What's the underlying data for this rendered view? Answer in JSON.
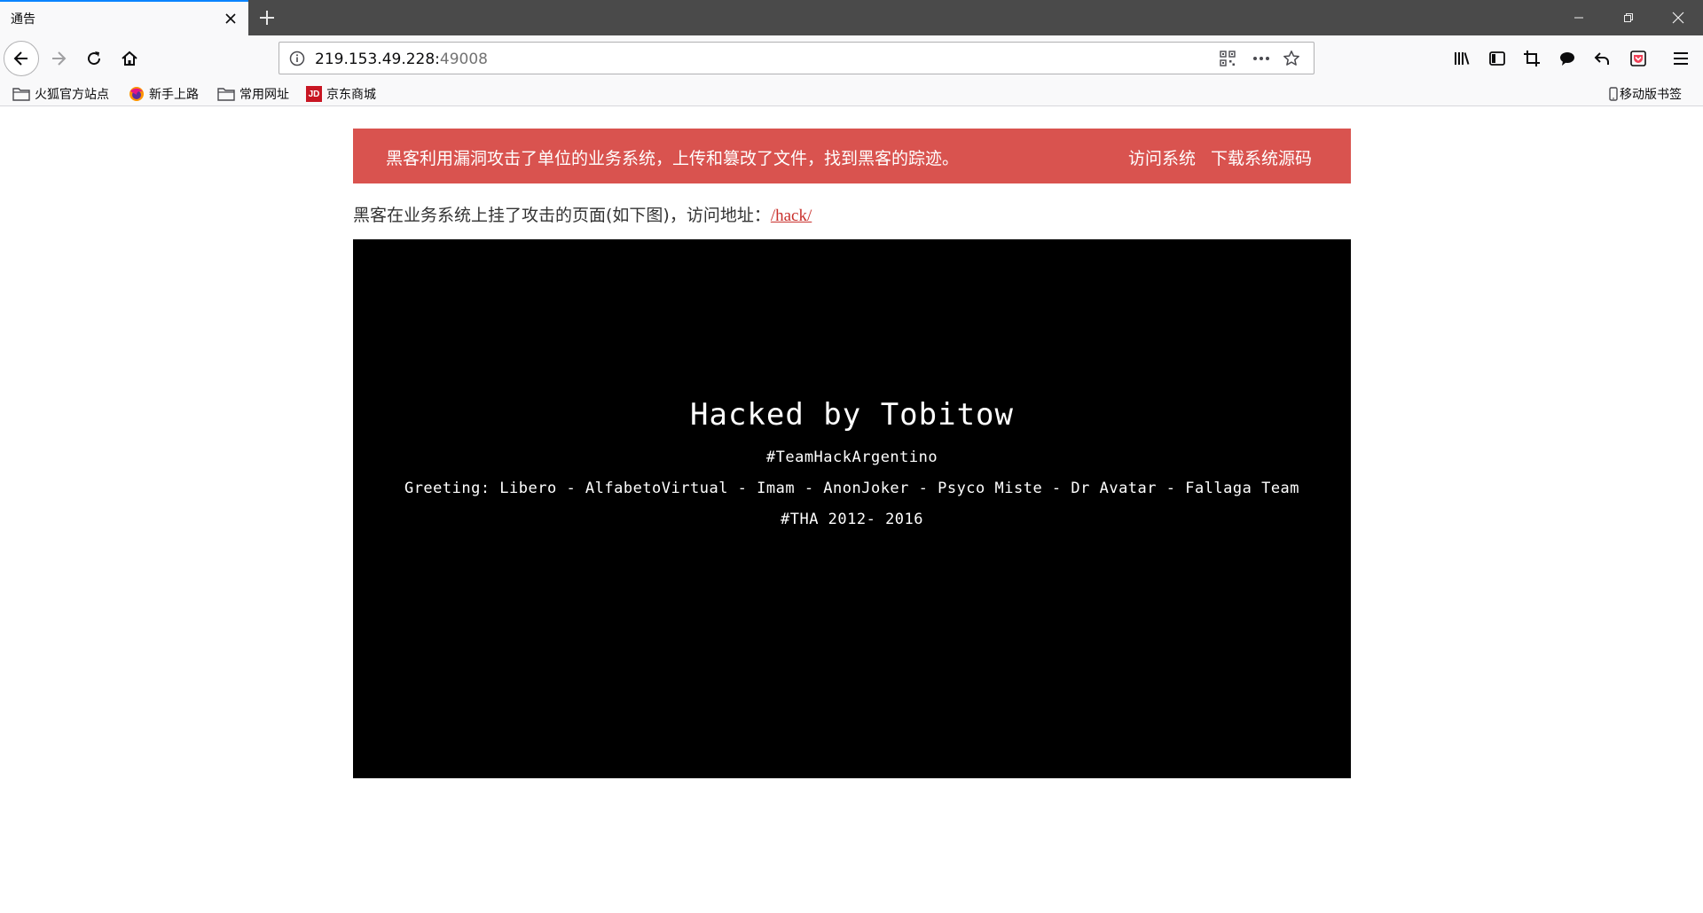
{
  "browser": {
    "tab_title": "通告",
    "url_host": "219.153.49.228:",
    "url_port": "49008"
  },
  "bookmarks": [
    {
      "label": "火狐官方站点",
      "icon": "folder-icon"
    },
    {
      "label": "新手上路",
      "icon": "firefox-icon"
    },
    {
      "label": "常用网址",
      "icon": "folder-icon"
    },
    {
      "label": "京东商城",
      "icon": "jd-icon",
      "icon_text": "JD"
    }
  ],
  "mobile_bookmarks": "移动版书签",
  "banner": {
    "message": "黑客利用漏洞攻击了单位的业务系统，上传和篡改了文件，找到黑客的踪迹。",
    "visit_link": "访问系统",
    "download_link": "下载系统源码",
    "color": "#d9534f"
  },
  "intro": {
    "text": "黑客在业务系统上挂了攻击的页面(如下图)，访问地址：",
    "link": "/hack/"
  },
  "hack_page": {
    "title": "Hacked by Tobitow",
    "tag": "#TeamHackArgentino",
    "greeting": "Greeting: Libero - AlfabetoVirtual - Imam - AnonJoker - Psyco Miste - Dr Avatar - Fallaga Team",
    "footer": "#THA 2012- 2016"
  }
}
